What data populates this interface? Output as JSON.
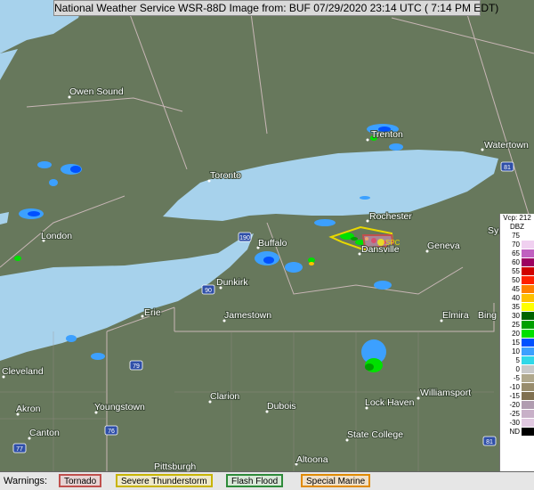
{
  "header": {
    "title": "National Weather Service WSR-88D Image from: BUF 07/29/2020 23:14 UTC ( 7:14 PM EDT)"
  },
  "colors": {
    "land": "#67785c",
    "water": "#a7d2ec",
    "border": "#c8b6b6"
  },
  "map": {
    "cities": [
      "Owen Sound",
      "Toronto",
      "London",
      "Buffalo",
      "Dunkirk",
      "Jamestown",
      "Erie",
      "Cleveland",
      "Akron",
      "Canton",
      "Youngstown",
      "Clarion",
      "Dubois",
      "Lock Haven",
      "Williamsport",
      "State College",
      "Altoona",
      "Pittsburgh",
      "Rochester",
      "Geneva",
      "Dansville",
      "Elmira",
      "Bing",
      "Trenton",
      "Watertown",
      "Syr"
    ],
    "highways": [
      "190",
      "90",
      "79",
      "76",
      "77",
      "81",
      "81"
    ],
    "marker": "SPC"
  },
  "warnings": {
    "label": "Warnings:",
    "items": [
      {
        "label": "Tornado",
        "color": "#c0504d"
      },
      {
        "label": "Severe Thunderstorm",
        "color": "#c8b400"
      },
      {
        "label": "Flash Flood",
        "color": "#2e8b3a"
      },
      {
        "label": "Special Marine",
        "color": "#e08a00"
      }
    ]
  },
  "legend": {
    "title": "Vcp: 212",
    "units": "DBZ",
    "levels": [
      {
        "v": "75",
        "c": "#ffffff"
      },
      {
        "v": "70",
        "c": "#f0d0f0"
      },
      {
        "v": "65",
        "c": "#c060c0"
      },
      {
        "v": "60",
        "c": "#9c0060"
      },
      {
        "v": "55",
        "c": "#d00000"
      },
      {
        "v": "50",
        "c": "#ff2000"
      },
      {
        "v": "45",
        "c": "#ff8000"
      },
      {
        "v": "40",
        "c": "#ffc000"
      },
      {
        "v": "35",
        "c": "#ffff00"
      },
      {
        "v": "30",
        "c": "#006400"
      },
      {
        "v": "25",
        "c": "#00a000"
      },
      {
        "v": "20",
        "c": "#00e000"
      },
      {
        "v": "15",
        "c": "#0050ff"
      },
      {
        "v": "10",
        "c": "#3ca0ff"
      },
      {
        "v": "5",
        "c": "#30d8e8"
      },
      {
        "v": "0",
        "c": "#c8c8c8"
      },
      {
        "v": "-5",
        "c": "#b0a88c"
      },
      {
        "v": "-10",
        "c": "#988c6c"
      },
      {
        "v": "-15",
        "c": "#807050"
      },
      {
        "v": "-20",
        "c": "#b09cb0"
      },
      {
        "v": "-25",
        "c": "#c8b0c8"
      },
      {
        "v": "-30",
        "c": "#e0c8e0"
      },
      {
        "v": "ND",
        "c": "#000000"
      }
    ]
  }
}
